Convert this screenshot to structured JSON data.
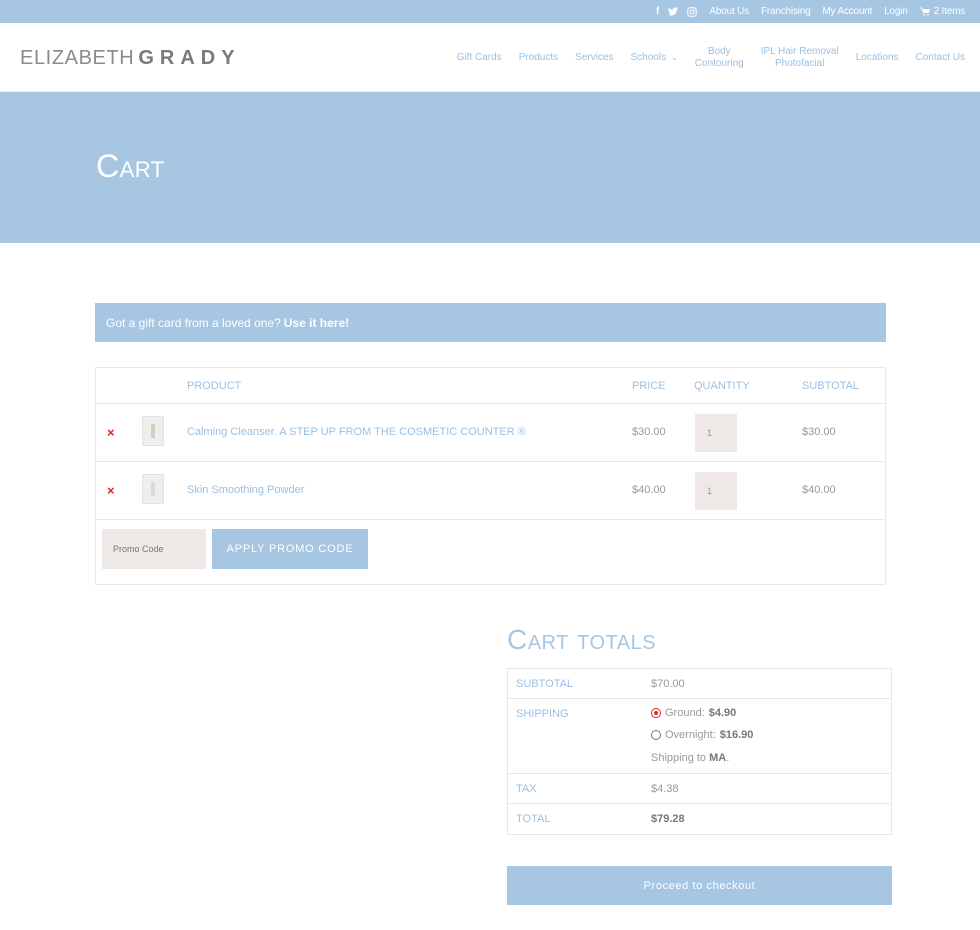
{
  "topbar": {
    "social": [
      {
        "icon": "facebook-icon",
        "glyph": "f"
      },
      {
        "icon": "twitter-icon",
        "glyph": "🐦"
      },
      {
        "icon": "instagram-icon",
        "glyph": "◎"
      }
    ],
    "links": [
      "About Us",
      "Franchising",
      "My Account",
      "Login"
    ],
    "cart_label": "2 Items"
  },
  "header": {
    "logo_thin": "ELIZABETH",
    "logo_bold": "GRADY",
    "nav": [
      "Gift Cards",
      "Products",
      "Services",
      "Schools",
      "Body Contouring",
      "IPL Hair Removal Photofacial",
      "Locations",
      "Contact Us"
    ],
    "nav_split": {
      "body_1": "Body",
      "body_2": "Contouring",
      "ipl_1": "IPL Hair Removal",
      "ipl_2": "Photofacial"
    }
  },
  "hero": {
    "title": "Cart"
  },
  "notice": {
    "text": "Got a gift card from a loved one?",
    "link": "Use it here!"
  },
  "cart": {
    "headers": {
      "product": "PRODUCT",
      "price": "PRICE",
      "quantity": "QUANTITY",
      "subtotal": "SUBTOTAL"
    },
    "items": [
      {
        "name": "Calming Cleanser. A STEP UP FROM THE COSMETIC COUNTER ®",
        "price": "$30.00",
        "quantity": "1",
        "subtotal": "$30.00"
      },
      {
        "name": "Skin Smoothing Powder",
        "price": "$40.00",
        "quantity": "1",
        "subtotal": "$40.00"
      }
    ],
    "remove_glyph": "×",
    "promo_placeholder": "Promo Code",
    "promo_button": "APPLY PROMO CODE"
  },
  "totals": {
    "title": "Cart totals",
    "subtotal_label": "SUBTOTAL",
    "subtotal": "$70.00",
    "shipping_label": "SHIPPING",
    "shipping_options": [
      {
        "label": "Ground:",
        "price": "$4.90",
        "selected": true
      },
      {
        "label": "Overnight:",
        "price": "$16.90",
        "selected": false
      }
    ],
    "shipping_to_prefix": "Shipping to",
    "shipping_to_state": "MA",
    "tax_label": "TAX",
    "tax": "$4.38",
    "total_label": "TOTAL",
    "total": "$79.28",
    "checkout_label": "Proceed to checkout"
  },
  "colors": {
    "accent": "#a6c6e2",
    "link": "#9bbfe0",
    "remove": "#e2231a"
  }
}
